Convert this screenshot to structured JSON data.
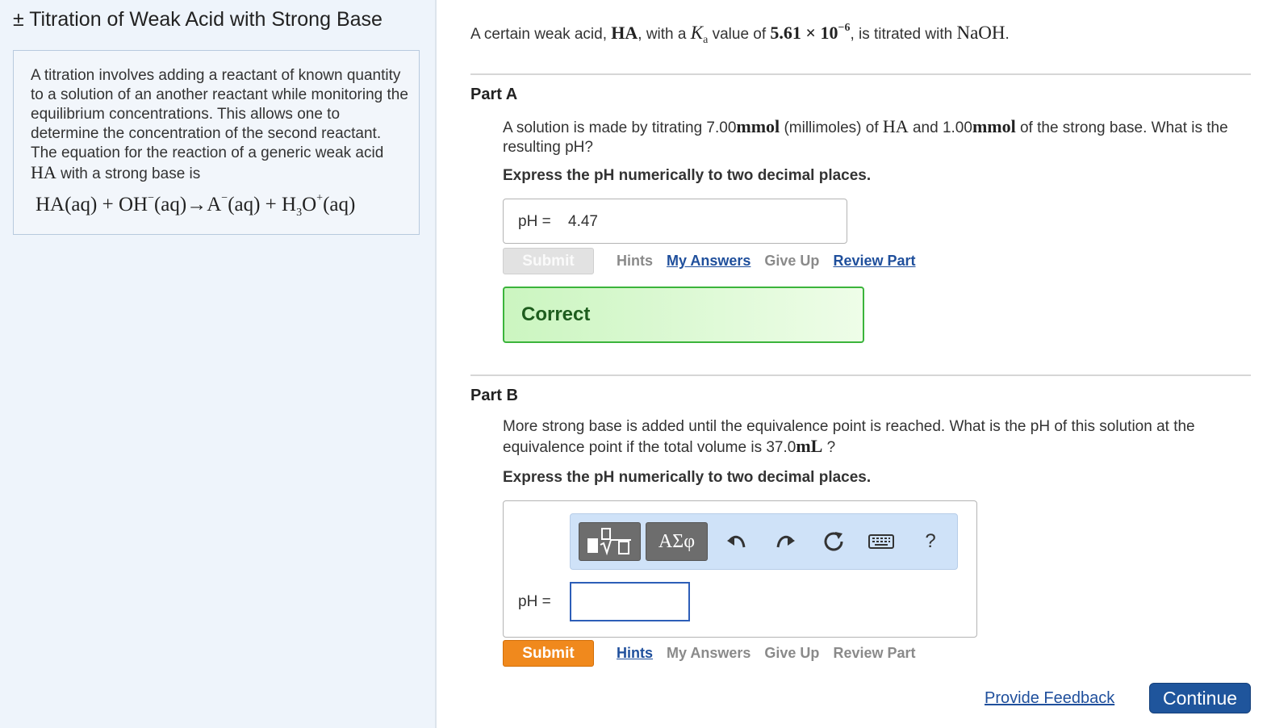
{
  "sidebar": {
    "title": "± Titration of Weak Acid with Strong Base",
    "intro_text": "A titration involves adding a reactant of known quantity to a solution of an another reactant while monitoring the equilibrium concentrations. This allows one to determine the concentration of the second reactant. The equation for the reaction of a generic weak acid",
    "intro_acid": "HA",
    "intro_text_end": "with a strong base is",
    "equation": {
      "r1": "HA(aq) + OH",
      "r1_charge": "−",
      "r1_end": "(aq)",
      "arrow": "→",
      "p1": "A",
      "p1_charge": "−",
      "p1_end": "(aq) + H",
      "p2_sub": "3",
      "p2": "O",
      "p2_charge": "+",
      "p2_end": "(aq)"
    }
  },
  "problem": {
    "s1": "A certain weak acid,",
    "acid": "HA",
    "s2": ", with a",
    "ka_k": "K",
    "ka_sub": "a",
    "s3": "value of",
    "ka_value": "5.61 × 10",
    "ka_exp": "−6",
    "s4": ", is titrated with",
    "base": "NaOH",
    "s5": "."
  },
  "part_a": {
    "title": "Part A",
    "q1": "A solution is made by titrating 7.00",
    "q_unit1": "mmol",
    "q2": "(millimoles) of",
    "q_acid": "HA",
    "q3": "and 1.00",
    "q_unit2": "mmol",
    "q4": "of the strong base. What is the resulting pH?",
    "instruction": "Express the pH numerically to two decimal places.",
    "answer_label": "pH =",
    "answer_value": "4.47",
    "submit": "Submit",
    "links": [
      "Hints",
      "My Answers",
      "Give Up",
      "Review Part"
    ],
    "feedback": "Correct"
  },
  "part_b": {
    "title": "Part B",
    "q1": "More strong base is added until the equivalence point is reached. What is the pH of this solution at the equivalence point if the total volume is 37.0",
    "q_unit": "mL",
    "q2": "?",
    "instruction": "Express the pH numerically to two decimal places.",
    "toolbar": {
      "templates": "√",
      "symbols": "ΑΣφ",
      "undo": "↶",
      "redo": "↷",
      "reset": "↻",
      "keyboard": "⌨",
      "help": "?"
    },
    "answer_label": "pH =",
    "answer_value": "",
    "submit": "Submit",
    "links": [
      "Hints",
      "My Answers",
      "Give Up",
      "Review Part"
    ]
  },
  "footer": {
    "feedback": "Provide Feedback",
    "continue": "Continue"
  }
}
